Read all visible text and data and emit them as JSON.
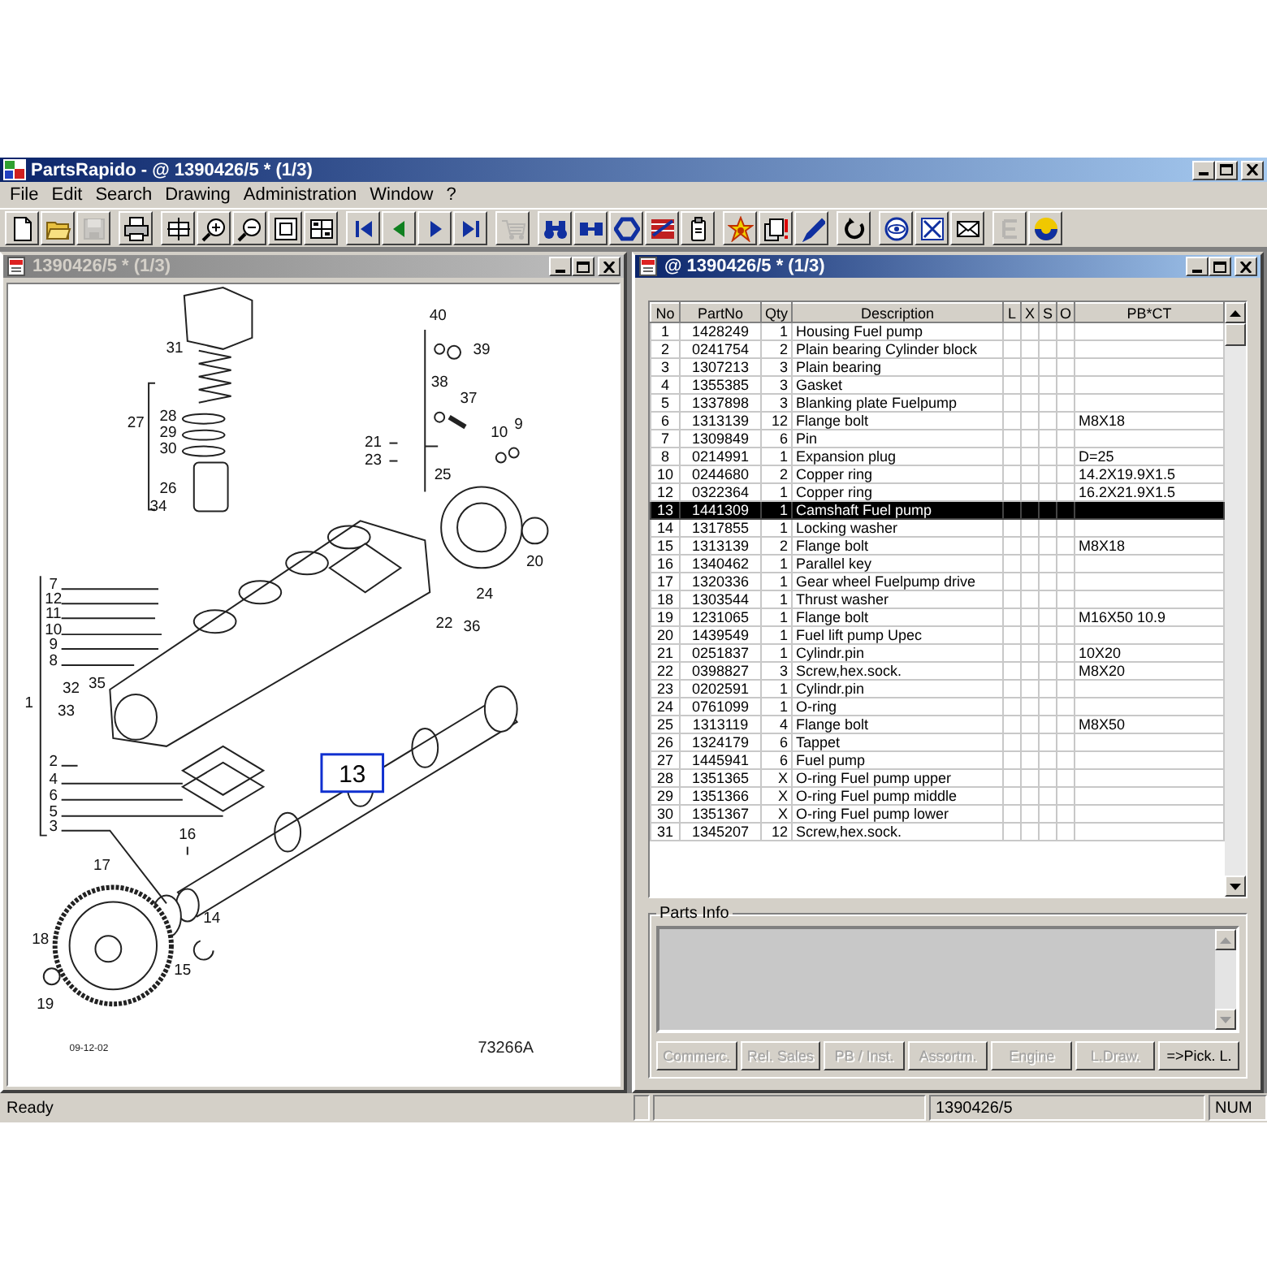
{
  "app": {
    "title": "PartsRapido - @ 1390426/5 * (1/3)"
  },
  "menu": [
    "File",
    "Edit",
    "Search",
    "Drawing",
    "Administration",
    "Window",
    "?"
  ],
  "toolbar": [
    [
      {
        "kind": "new-page",
        "disabled": false
      },
      {
        "kind": "folder",
        "disabled": false
      },
      {
        "kind": "floppy-disk",
        "disabled": true
      }
    ],
    [
      {
        "kind": "printer",
        "disabled": false
      }
    ],
    [
      {
        "kind": "move",
        "disabled": false
      },
      {
        "kind": "zoom-in",
        "disabled": false
      },
      {
        "kind": "zoom-out",
        "disabled": false
      },
      {
        "kind": "frame",
        "disabled": false
      },
      {
        "kind": "grid",
        "disabled": false
      }
    ],
    [
      {
        "kind": "skip-back",
        "disabled": false
      },
      {
        "kind": "triangle-left",
        "disabled": false
      },
      {
        "kind": "triangle-right",
        "disabled": false
      },
      {
        "kind": "skip-forward",
        "disabled": false
      }
    ],
    [
      {
        "kind": "cart",
        "disabled": true
      }
    ],
    [
      {
        "kind": "binoculars",
        "disabled": false
      },
      {
        "kind": "connector",
        "disabled": false
      },
      {
        "kind": "hexagon",
        "disabled": false
      },
      {
        "kind": "flag",
        "disabled": false
      },
      {
        "kind": "clipboard",
        "disabled": false
      }
    ],
    [
      {
        "kind": "star",
        "disabled": false
      },
      {
        "kind": "pages",
        "disabled": false
      },
      {
        "kind": "pen",
        "disabled": false
      }
    ],
    [
      {
        "kind": "refresh",
        "disabled": false
      }
    ],
    [
      {
        "kind": "eye",
        "disabled": false
      },
      {
        "kind": "expand",
        "disabled": false
      },
      {
        "kind": "envelope",
        "disabled": false
      }
    ],
    [
      {
        "kind": "lines",
        "disabled": true
      },
      {
        "kind": "disc",
        "disabled": false
      }
    ]
  ],
  "drawing_window": {
    "title": "1390426/5 * (1/3)",
    "active": false,
    "callouts": [
      {
        "label": "40",
        "selected": false
      },
      {
        "label": "39",
        "selected": false
      },
      {
        "label": "31",
        "selected": false
      },
      {
        "label": "38",
        "selected": false
      },
      {
        "label": "37",
        "selected": false
      },
      {
        "label": "27",
        "selected": false
      },
      {
        "label": "28",
        "selected": false
      },
      {
        "label": "29",
        "selected": false
      },
      {
        "label": "30",
        "selected": false
      },
      {
        "label": "21",
        "selected": false
      },
      {
        "label": "23",
        "selected": false
      },
      {
        "label": "10",
        "selected": false
      },
      {
        "label": "9",
        "selected": false
      },
      {
        "label": "25",
        "selected": false
      },
      {
        "label": "26",
        "selected": false
      },
      {
        "label": "20",
        "selected": false
      },
      {
        "label": "34",
        "selected": false
      },
      {
        "label": "24",
        "selected": false
      },
      {
        "label": "22",
        "selected": false
      },
      {
        "label": "36",
        "selected": false
      },
      {
        "label": "7",
        "selected": false
      },
      {
        "label": "12",
        "selected": false
      },
      {
        "label": "11",
        "selected": false
      },
      {
        "label": "10",
        "selected": false
      },
      {
        "label": "9",
        "selected": false
      },
      {
        "label": "8",
        "selected": false
      },
      {
        "label": "32",
        "selected": false
      },
      {
        "label": "35",
        "selected": false
      },
      {
        "label": "1",
        "selected": false
      },
      {
        "label": "33",
        "selected": false
      },
      {
        "label": "2",
        "selected": false
      },
      {
        "label": "4",
        "selected": false
      },
      {
        "label": "6",
        "selected": false
      },
      {
        "label": "5",
        "selected": false
      },
      {
        "label": "3",
        "selected": false
      },
      {
        "label": "13",
        "selected": true
      },
      {
        "label": "16",
        "selected": false
      },
      {
        "label": "17",
        "selected": false
      },
      {
        "label": "14",
        "selected": false
      },
      {
        "label": "15",
        "selected": false
      },
      {
        "label": "18",
        "selected": false
      },
      {
        "label": "19",
        "selected": false
      }
    ],
    "date_code": "09-12-02",
    "figure_number": "73266A"
  },
  "parts_window": {
    "title": "@ 1390426/5 * (1/3)",
    "active": true,
    "columns": [
      "No",
      "PartNo",
      "Qty",
      "Description",
      "L",
      "X",
      "S",
      "O",
      "PB*CT"
    ],
    "rows": [
      {
        "no": "1",
        "part_no": "1428249",
        "qty": "1",
        "description": "Housing Fuel pump",
        "selected": false
      },
      {
        "no": "2",
        "part_no": "0241754",
        "qty": "2",
        "description": "Plain bearing Cylinder block",
        "selected": false
      },
      {
        "no": "3",
        "part_no": "1307213",
        "qty": "3",
        "description": "Plain bearing",
        "selected": false
      },
      {
        "no": "4",
        "part_no": "1355385",
        "qty": "3",
        "description": "Gasket",
        "selected": false
      },
      {
        "no": "5",
        "part_no": "1337898",
        "qty": "3",
        "description": "Blanking plate Fuelpump",
        "selected": false
      },
      {
        "no": "6",
        "part_no": "1313139",
        "qty": "12",
        "description": "Flange bolt",
        "pb_ct": "M8X18",
        "selected": false
      },
      {
        "no": "7",
        "part_no": "1309849",
        "qty": "6",
        "description": "Pin",
        "selected": false
      },
      {
        "no": "8",
        "part_no": "0214991",
        "qty": "1",
        "description": "Expansion plug",
        "pb_ct": "D=25",
        "selected": false
      },
      {
        "no": "10",
        "part_no": "0244680",
        "qty": "2",
        "description": "Copper ring",
        "pb_ct": "14.2X19.9X1.5",
        "selected": false
      },
      {
        "no": "12",
        "part_no": "0322364",
        "qty": "1",
        "description": "Copper ring",
        "pb_ct": "16.2X21.9X1.5",
        "selected": false
      },
      {
        "no": "13",
        "part_no": "1441309",
        "qty": "1",
        "description": "Camshaft Fuel pump",
        "selected": true
      },
      {
        "no": "14",
        "part_no": "1317855",
        "qty": "1",
        "description": "Locking washer",
        "selected": false
      },
      {
        "no": "15",
        "part_no": "1313139",
        "qty": "2",
        "description": "Flange bolt",
        "pb_ct": "M8X18",
        "selected": false
      },
      {
        "no": "16",
        "part_no": "1340462",
        "qty": "1",
        "description": "Parallel key",
        "selected": false
      },
      {
        "no": "17",
        "part_no": "1320336",
        "qty": "1",
        "description": "Gear wheel Fuelpump drive",
        "selected": false
      },
      {
        "no": "18",
        "part_no": "1303544",
        "qty": "1",
        "description": "Thrust washer",
        "selected": false
      },
      {
        "no": "19",
        "part_no": "1231065",
        "qty": "1",
        "description": "Flange bolt",
        "pb_ct": "M16X50 10.9",
        "selected": false
      },
      {
        "no": "20",
        "part_no": "1439549",
        "qty": "1",
        "description": "Fuel lift pump Upec",
        "selected": false
      },
      {
        "no": "21",
        "part_no": "0251837",
        "qty": "1",
        "description": "Cylindr.pin",
        "pb_ct": "10X20",
        "selected": false
      },
      {
        "no": "22",
        "part_no": "0398827",
        "qty": "3",
        "description": "Screw,hex.sock.",
        "pb_ct": "M8X20",
        "selected": false
      },
      {
        "no": "23",
        "part_no": "0202591",
        "qty": "1",
        "description": "Cylindr.pin",
        "selected": false
      },
      {
        "no": "24",
        "part_no": "0761099",
        "qty": "1",
        "description": "O-ring",
        "selected": false
      },
      {
        "no": "25",
        "part_no": "1313119",
        "qty": "4",
        "description": "Flange bolt",
        "pb_ct": "M8X50",
        "selected": false
      },
      {
        "no": "26",
        "part_no": "1324179",
        "qty": "6",
        "description": "Tappet",
        "selected": false
      },
      {
        "no": "27",
        "part_no": "1445941",
        "qty": "6",
        "description": "Fuel pump",
        "selected": false
      },
      {
        "no": "28",
        "part_no": "1351365",
        "qty": "X",
        "description": "O-ring Fuel pump upper",
        "selected": false
      },
      {
        "no": "29",
        "part_no": "1351366",
        "qty": "X",
        "description": "O-ring Fuel pump middle",
        "selected": false
      },
      {
        "no": "30",
        "part_no": "1351367",
        "qty": "X",
        "description": "O-ring Fuel pump lower",
        "selected": false
      },
      {
        "no": "31",
        "part_no": "1345207",
        "qty": "12",
        "description": "Screw,hex.sock.",
        "selected": false
      }
    ],
    "parts_info": {
      "title": "Parts Info",
      "buttons": [
        {
          "label": "Commerc.",
          "disabled": true
        },
        {
          "label": "Rel. Sales",
          "disabled": true
        },
        {
          "label": "PB / Inst.",
          "disabled": true
        },
        {
          "label": "Assortm.",
          "disabled": true
        },
        {
          "label": "Engine",
          "disabled": true
        },
        {
          "label": "L.Draw.",
          "disabled": true
        },
        {
          "label": "=>Pick. L.",
          "disabled": false
        }
      ]
    }
  },
  "status_bar": {
    "message": "Ready",
    "document": "1390426/5",
    "num_lock": "NUM"
  }
}
